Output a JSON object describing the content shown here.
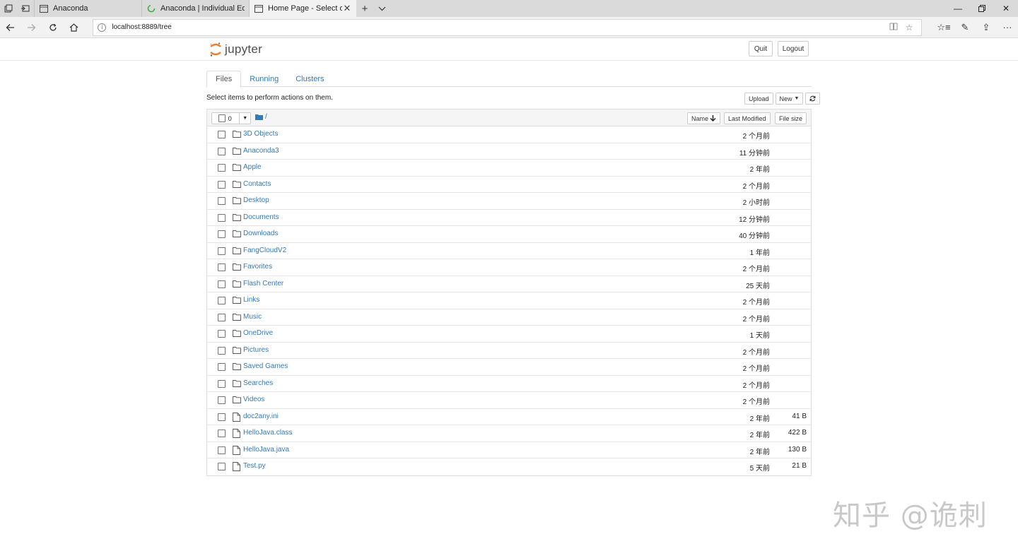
{
  "browser": {
    "tabs": [
      {
        "title": "Anaconda",
        "active": false
      },
      {
        "title": "Anaconda | Individual Editic",
        "active": false
      },
      {
        "title": "Home Page - Select or c",
        "active": true
      }
    ],
    "url": "localhost:8889/tree"
  },
  "header": {
    "logo_text": "jupyter",
    "quit_label": "Quit",
    "logout_label": "Logout"
  },
  "tabs": {
    "files": "Files",
    "running": "Running",
    "clusters": "Clusters"
  },
  "toolbar": {
    "hint": "Select items to perform actions on them.",
    "upload": "Upload",
    "new": "New"
  },
  "list_header": {
    "selected_count": "0",
    "breadcrumb": "/",
    "name": "Name",
    "last_modified": "Last Modified",
    "file_size": "File size"
  },
  "items": [
    {
      "name": "3D Objects",
      "type": "folder",
      "modified": "2 个月前",
      "size": ""
    },
    {
      "name": "Anaconda3",
      "type": "folder",
      "modified": "11 分钟前",
      "size": ""
    },
    {
      "name": "Apple",
      "type": "folder",
      "modified": "2 年前",
      "size": ""
    },
    {
      "name": "Contacts",
      "type": "folder",
      "modified": "2 个月前",
      "size": ""
    },
    {
      "name": "Desktop",
      "type": "folder",
      "modified": "2 小时前",
      "size": ""
    },
    {
      "name": "Documents",
      "type": "folder",
      "modified": "12 分钟前",
      "size": ""
    },
    {
      "name": "Downloads",
      "type": "folder",
      "modified": "40 分钟前",
      "size": ""
    },
    {
      "name": "FangCloudV2",
      "type": "folder",
      "modified": "1 年前",
      "size": ""
    },
    {
      "name": "Favorites",
      "type": "folder",
      "modified": "2 个月前",
      "size": ""
    },
    {
      "name": "Flash Center",
      "type": "folder",
      "modified": "25 天前",
      "size": ""
    },
    {
      "name": "Links",
      "type": "folder",
      "modified": "2 个月前",
      "size": ""
    },
    {
      "name": "Music",
      "type": "folder",
      "modified": "2 个月前",
      "size": ""
    },
    {
      "name": "OneDrive",
      "type": "folder",
      "modified": "1 天前",
      "size": ""
    },
    {
      "name": "Pictures",
      "type": "folder",
      "modified": "2 个月前",
      "size": ""
    },
    {
      "name": "Saved Games",
      "type": "folder",
      "modified": "2 个月前",
      "size": ""
    },
    {
      "name": "Searches",
      "type": "folder",
      "modified": "2 个月前",
      "size": ""
    },
    {
      "name": "Videos",
      "type": "folder",
      "modified": "2 个月前",
      "size": ""
    },
    {
      "name": "doc2any.ini",
      "type": "file",
      "modified": "2 年前",
      "size": "41 B"
    },
    {
      "name": "HelloJava.class",
      "type": "file",
      "modified": "2 年前",
      "size": "422 B"
    },
    {
      "name": "HelloJava.java",
      "type": "file",
      "modified": "2 年前",
      "size": "130 B"
    },
    {
      "name": "Test.py",
      "type": "file",
      "modified": "5 天前",
      "size": "21 B"
    }
  ],
  "watermark": "知乎 @诡刺",
  "colors": {
    "link": "#337ab7",
    "jupyter_orange": "#f37726"
  }
}
